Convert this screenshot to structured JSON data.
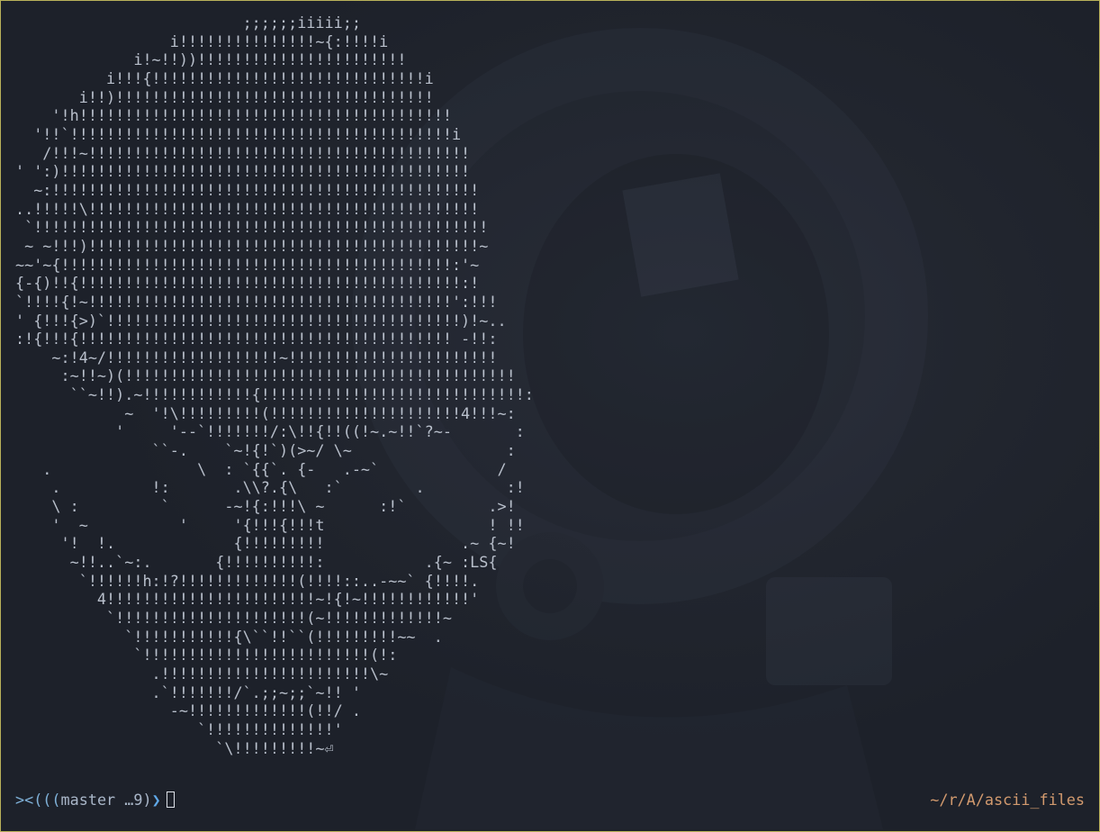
{
  "terminal": {
    "ascii_art": "                         ;;;;;;iiiii;;\n                 i!!!!!!!!!!!!!!!~{:!!!!i\n             i!~!!))!!!!!!!!!!!!!!!!!!!!!!!\n          i!!!{!!!!!!!!!!!!!!!!!!!!!!!!!!!!!!i\n       i!!)!!!!!!!!!!!!!!!!!!!!!!!!!!!!!!!!!!!\n    '!h!!!!!!!!!!!!!!!!!!!!!!!!!!!!!!!!!!!!!!!!!\n  '!!`!!!!!!!!!!!!!!!!!!!!!!!!!!!!!!!!!!!!!!!!!!i\n   /!!!~!!!!!!!!!!!!!!!!!!!!!!!!!!!!!!!!!!!!!!!!!!\n' ':)!!!!!!!!!!!!!!!!!!!!!!!!!!!!!!!!!!!!!!!!!!!!!\n  ~:!!!!!!!!!!!!!!!!!!!!!!!!!!!!!!!!!!!!!!!!!!!!!!!\n..!!!!!\\!!!!!!!!!!!!!!!!!!!!!!!!!!!!!!!!!!!!!!!!!!!\n `!!!!!!!!!!!!!!!!!!!!!!!!!!!!!!!!!!!!!!!!!!!!!!!!!!\n ~ ~!!!)!!!!!!!!!!!!!!!!!!!!!!!!!!!!!!!!!!!!!!!!!!!~\n~~'~{!!!!!!!!!!!!!!!!!!!!!!!!!!!!!!!!!!!!!!!!!!!:'~\n{-{)!!{!!!!!!!!!!!!!!!!!!!!!!!!!!!!!!!!!!!!!!!!!!:!\n`!!!!{!~!!!!!!!!!!!!!!!!!!!!!!!!!!!!!!!!!!!!!!!!':!!!\n' {!!!{>)`!!!!!!!!!!!!!!!!!!!!!!!!!!!!!!!!!!!!!!!)!~..\n:!{!!!{!!!!!!!!!!!!!!!!!!!!!!!!!!!!!!!!!!!!!!!!! -!!:\n    ~:!4~/!!!!!!!!!!!!!!!!!!!~!!!!!!!!!!!!!!!!!!!!!!!\n     :~!!~)(!!!!!!!!!!!!!!!!!!!!!!!!!!!!!!!!!!!!!!!!!!!\n      ``~!!).~!!!!!!!!!!!!{!!!!!!!!!!!!!!!!!!!!!!!!!!!!!:\n            ~  '!\\!!!!!!!!!(!!!!!!!!!!!!!!!!!!!!!4!!!~:\n           '     '--`!!!!!!!/:\\!!{!!((!~.~!!`?~-       :\n               ``-.    `~!{!`)(>~/ \\~                 :\n   .                \\  : `{{`. {-   .-~`             /\n    .          !:       .\\\\?.{\\   :`        .         :!\n    \\ :         `      -~!{:!!!\\ ~      :!`         .>!\n    '  ~          '     '{!!!{!!!t                  ! !!\n     '!  !.             {!!!!!!!!!               .~ {~!\n      ~!!..`~:.       {!!!!!!!!!!:           .{~ :LS{\n       `!!!!!!h:!?!!!!!!!!!!!!!(!!!!::..-~~` {!!!!.\n         4!!!!!!!!!!!!!!!!!!!!!!!~!{!~!!!!!!!!!!!!'\n          `!!!!!!!!!!!!!!!!!!!!!(~!!!!!!!!!!!!!~\n            `!!!!!!!!!!!{\\``!!``(!!!!!!!!!~~  .\n             `!!!!!!!!!!!!!!!!!!!!!!!!!(!:\n               .!!!!!!!!!!!!!!!!!!!!!!!\\~\n               .`!!!!!!!/`.;;~;;`~!! '\n                 -~!!!!!!!!!!!!!(!!/ .\n                    `!!!!!!!!!!!!!!'\n                      `\\!!!!!!!!!~⏎",
    "prompt": {
      "fish": "><(((",
      "branch": "master …9)",
      "arrow": "❯"
    },
    "cwd": "~/r/A/ascii_files"
  }
}
